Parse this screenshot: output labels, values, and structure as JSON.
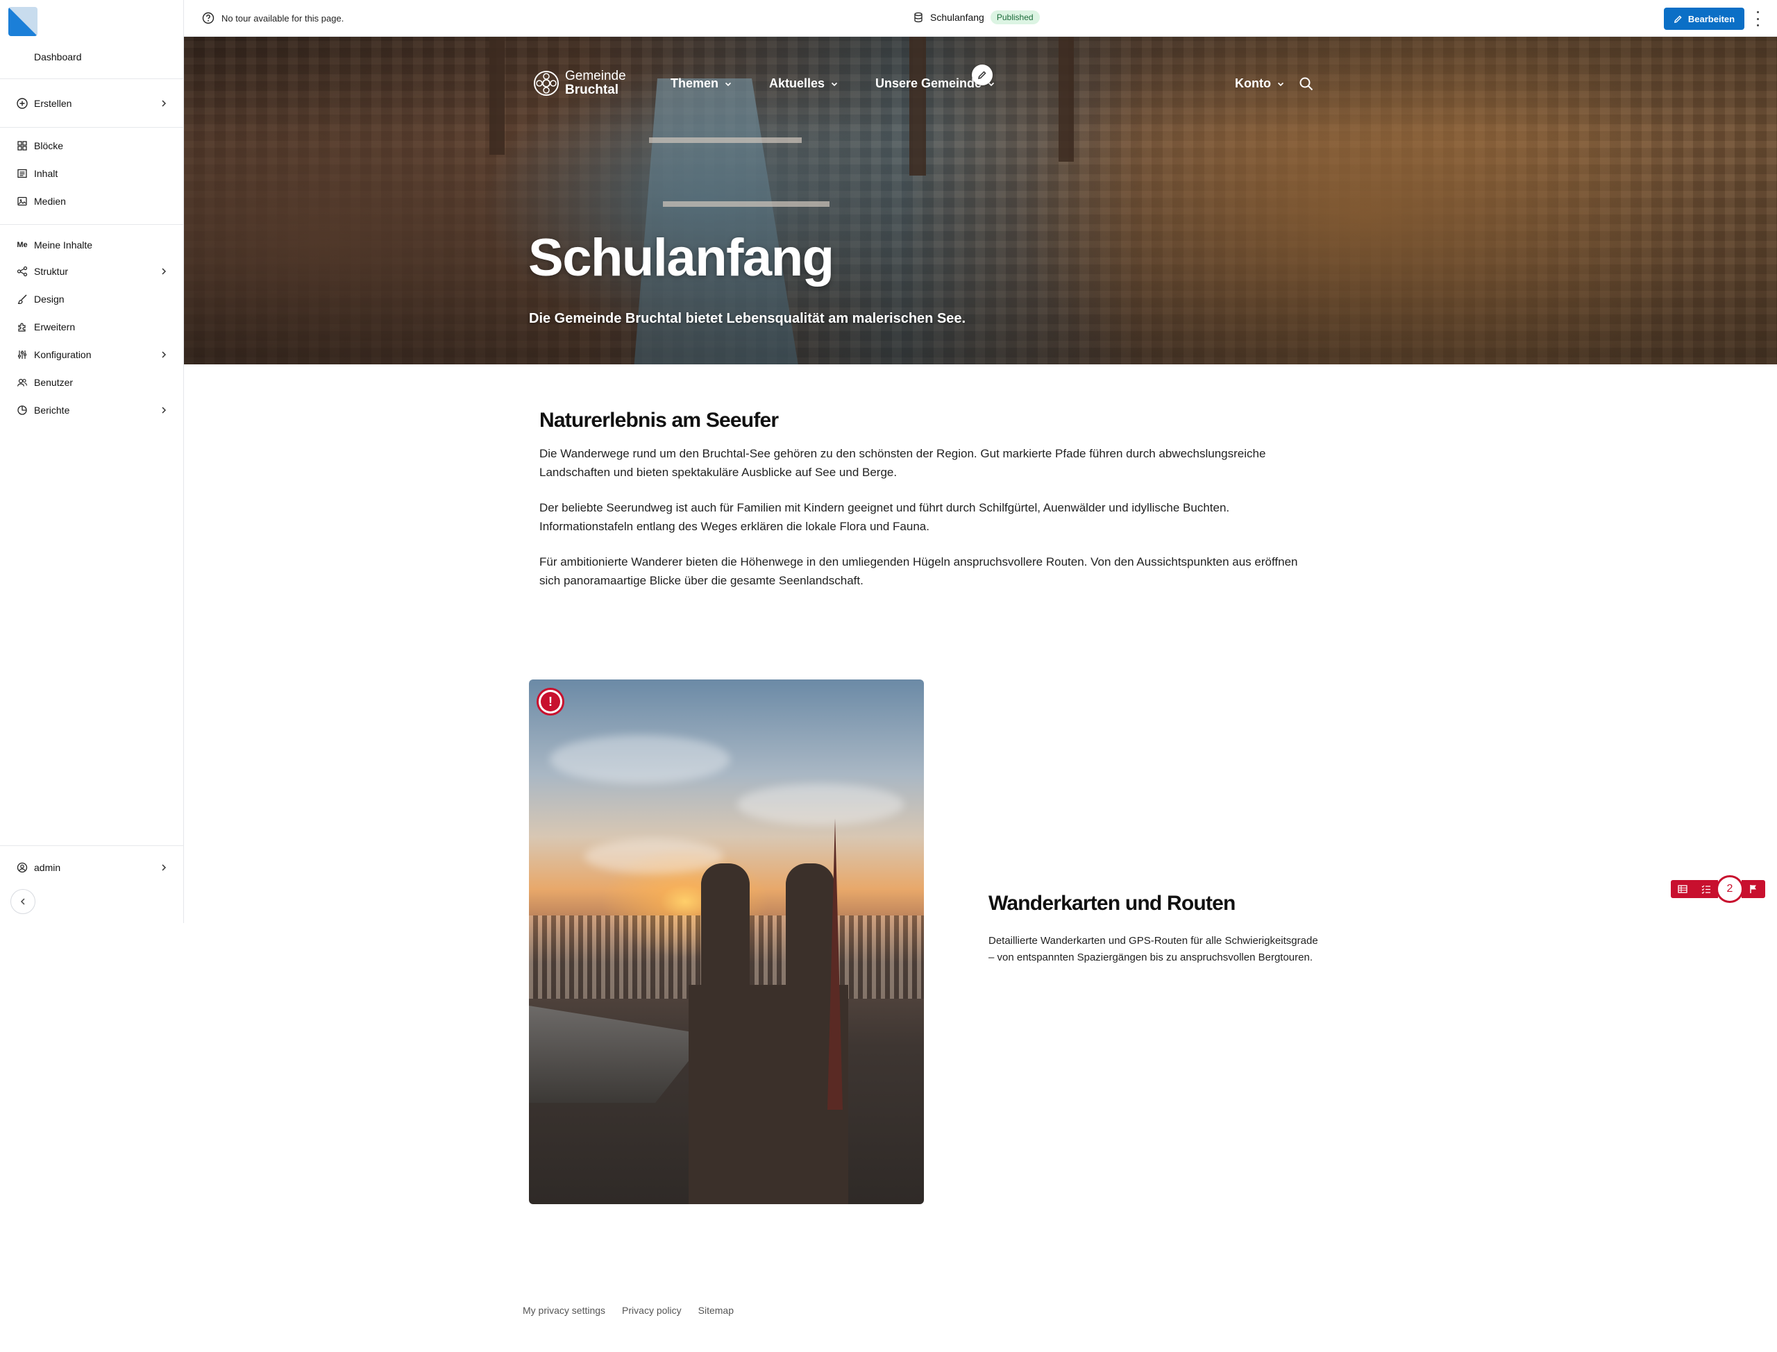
{
  "sidebar": {
    "dashboard_label": "Dashboard",
    "items": [
      {
        "label": "Erstellen",
        "icon": "plus-circle-icon",
        "has_submenu": true
      },
      {
        "label": "Blöcke",
        "icon": "grid-icon",
        "has_submenu": false
      },
      {
        "label": "Inhalt",
        "icon": "content-icon",
        "has_submenu": false
      },
      {
        "label": "Medien",
        "icon": "media-icon",
        "has_submenu": false
      },
      {
        "label": "Meine Inhalte",
        "icon_text": "Me",
        "has_submenu": false
      },
      {
        "label": "Struktur",
        "icon": "structure-icon",
        "has_submenu": true
      },
      {
        "label": "Design",
        "icon": "brush-icon",
        "has_submenu": false
      },
      {
        "label": "Erweitern",
        "icon": "puzzle-icon",
        "has_submenu": false
      },
      {
        "label": "Konfiguration",
        "icon": "sliders-icon",
        "has_submenu": true
      },
      {
        "label": "Benutzer",
        "icon": "users-icon",
        "has_submenu": false
      },
      {
        "label": "Berichte",
        "icon": "chart-icon",
        "has_submenu": true
      }
    ],
    "user_label": "admin"
  },
  "topbar": {
    "tour_text": "No tour available for this page.",
    "page_title": "Schulanfang",
    "status_badge": "Published",
    "edit_label": "Bearbeiten"
  },
  "site": {
    "logo_line1": "Gemeinde",
    "logo_line2": "Bruchtal",
    "nav": [
      {
        "label": "Themen"
      },
      {
        "label": "Aktuelles"
      },
      {
        "label": "Unsere Gemeinde"
      },
      {
        "label": "Konto"
      }
    ]
  },
  "hero": {
    "title": "Schulanfang",
    "subtitle": "Die Gemeinde Bruchtal bietet Lebensqualität am malerischen See."
  },
  "section1": {
    "heading": "Naturerlebnis am Seeufer",
    "paragraphs": [
      "Die Wanderwege rund um den Bruchtal-See gehören zu den schönsten der Region. Gut markierte Pfade führen durch abwechslungsreiche Landschaften und bieten spektakuläre Ausblicke auf See und Berge.",
      "Der beliebte Seerundweg ist auch für Familien mit Kindern geeignet und führt durch Schilfgürtel, Auenwälder und idyllische Buchten. Informationstafeln entlang des Weges erklären die lokale Flora und Fauna.",
      "Für ambitionierte Wanderer bieten die Höhenwege in den umliegenden Hügeln anspruchsvollere Routen. Von den Aussichtspunkten aus eröffnen sich panoramaartige Blicke über die gesamte Seenlandschaft."
    ]
  },
  "section2": {
    "warning_symbol": "!",
    "heading": "Wanderkarten und Routen",
    "text": "Detaillierte Wanderkarten und GPS-Routen für alle Schwierigkeitsgrade – von entspannten Spaziergängen bis zu anspruchsvollen Bergtouren."
  },
  "review_toolbar": {
    "count": "2"
  },
  "footer": {
    "links": [
      "My privacy settings",
      "Privacy policy",
      "Sitemap"
    ]
  },
  "colors": {
    "accent_blue": "#0b6fc6",
    "alert_red": "#c8102e",
    "published_bg": "#dcf4e3",
    "published_text": "#1b6b3a"
  }
}
